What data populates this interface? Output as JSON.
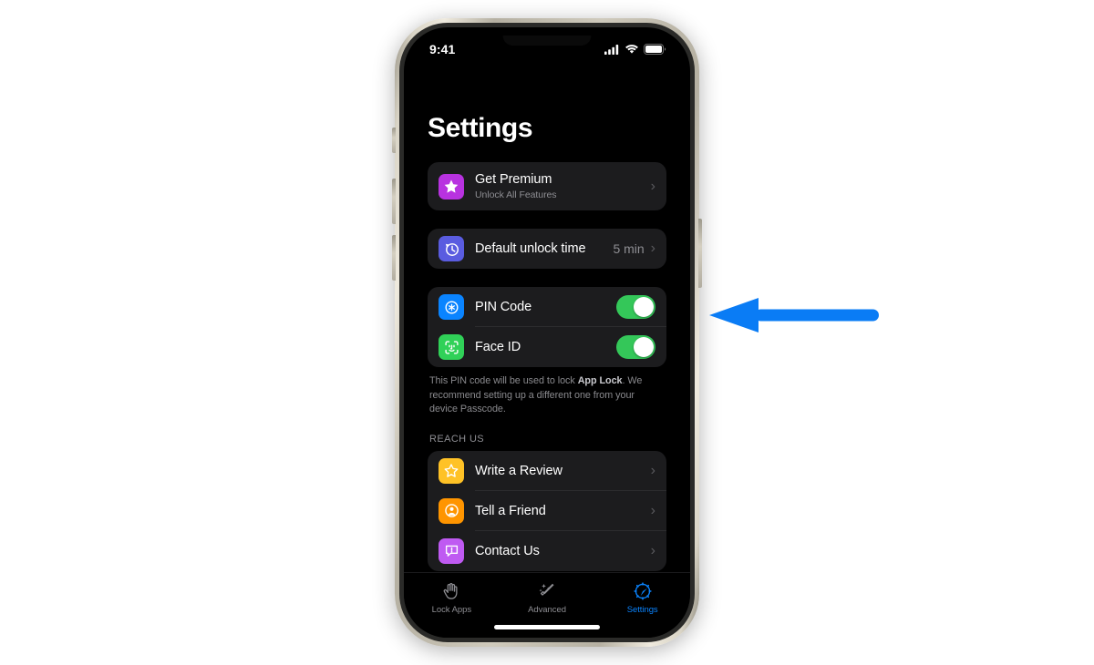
{
  "annotation": {
    "arrow_color": "#0a7cf5",
    "arrow_direction": "left",
    "arrow_name": "pointer-arrow"
  },
  "device": {
    "frame_color": "#cfcabc",
    "screen_background": "#000000"
  },
  "status_bar": {
    "time": "9:41",
    "icons": [
      "cellular-signal-icon",
      "wifi-icon",
      "battery-icon"
    ]
  },
  "screen": {
    "title": "Settings",
    "accent_color": "#0a84ff",
    "card_background": "#1c1c1e"
  },
  "premium_card": {
    "title": "Get Premium",
    "subtitle": "Unlock All Features",
    "icon": "star-badge-icon",
    "icon_color": "#b832e0",
    "chevron": "›"
  },
  "unlock_time_card": {
    "title": "Default unlock time",
    "value": "5 min",
    "icon": "clock-arrow-icon",
    "icon_color": "#5a5ce0",
    "chevron": "›"
  },
  "security_card": {
    "rows": [
      {
        "title": "PIN Code",
        "icon": "asterisk-circle-icon",
        "icon_color": "#0a84ff",
        "toggle_on": true
      },
      {
        "title": "Face ID",
        "icon": "faceid-icon",
        "icon_color": "#30d158",
        "toggle_on": true
      }
    ],
    "footnote_part1": "This PIN code will be used to lock ",
    "footnote_bold": "App Lock",
    "footnote_part2": ". We recommend setting up a different one from your device Passcode."
  },
  "reach_us": {
    "header": "REACH US",
    "rows": [
      {
        "title": "Write a Review",
        "icon": "star-outline-icon",
        "icon_color": "#ffc226",
        "chevron": "›"
      },
      {
        "title": "Tell a Friend",
        "icon": "person-circle-icon",
        "icon_color": "#ff9500",
        "chevron": "›"
      },
      {
        "title": "Contact Us",
        "icon": "message-exclamation-icon",
        "icon_color": "#bf5af2",
        "chevron": "›"
      }
    ]
  },
  "tab_bar": {
    "active_index": 2,
    "tabs": [
      {
        "label": "Lock Apps",
        "icon": "hand-raised-icon"
      },
      {
        "label": "Advanced",
        "icon": "magic-wand-sparkles-icon"
      },
      {
        "label": "Settings",
        "icon": "gear-icon"
      }
    ]
  }
}
